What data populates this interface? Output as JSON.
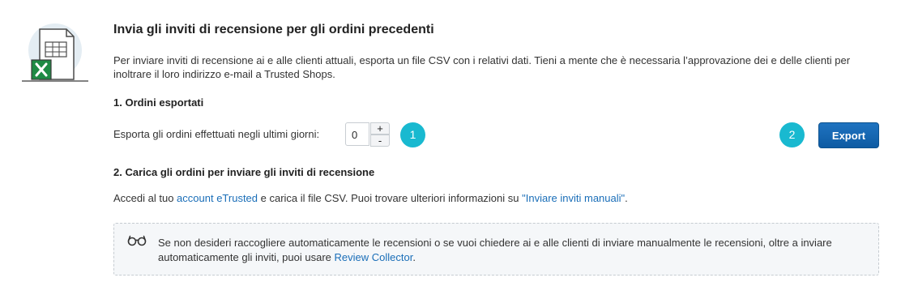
{
  "header": {
    "title": "Invia gli inviti di recensione per gli ordini precedenti",
    "intro": "Per inviare inviti di recensione ai e alle clienti attuali, esporta un file CSV con i relativi dati. Tieni a mente che è necessaria l’approvazione dei e delle clienti per inoltrare il loro indirizzo e-mail a Trusted Shops."
  },
  "step1": {
    "heading": "1. Ordini esportati",
    "label": "Esporta gli ordini effettuati negli ultimi giorni:",
    "days_value": "0",
    "plus": "+",
    "minus": "-",
    "badge": "1"
  },
  "export": {
    "badge": "2",
    "button": "Export"
  },
  "step2": {
    "heading": "2. Carica gli ordini per inviare gli inviti di recensione",
    "text_before": "Accedi al tuo ",
    "link1": "account eTrusted",
    "text_middle": " e carica il file CSV. Puoi trovare ulteriori informazioni su ",
    "link2": "\"Inviare inviti manuali\"",
    "text_after": "."
  },
  "note": {
    "icon": "glasses-icon",
    "text_before": "Se non desideri raccogliere automaticamente le recensioni o se vuoi chiedere ai e alle clienti di inviare manualmente le recensioni, oltre a inviare automaticamente gli inviti, puoi usare ",
    "link": "Review Collector",
    "text_after": "."
  },
  "colors": {
    "accent": "#19b9d0",
    "button": "#1566b0",
    "link": "#1a6eb8",
    "excel_green": "#1e8a44"
  }
}
